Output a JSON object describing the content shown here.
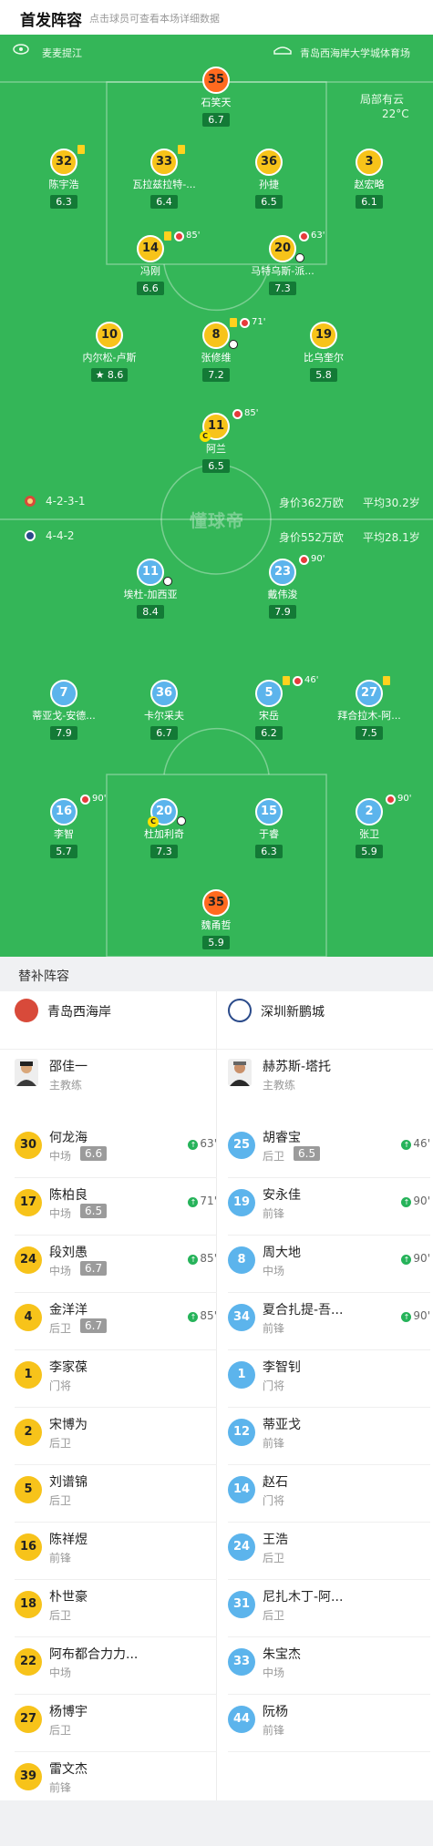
{
  "header": {
    "title": "首发阵容",
    "hint": "点击球员可查看本场详细数据"
  },
  "pitch": {
    "home_team": "麦麦提江",
    "venue": "青岛西海岸大学城体育场",
    "weather": "局部有云",
    "temperature": "22°C",
    "watermark": "懂球帝",
    "home_formation": "4-2-3-1",
    "home_value": "身价362万欧",
    "home_age": "平均30.2岁",
    "away_formation": "4-4-2",
    "away_value": "身价552万欧",
    "away_age": "平均28.1岁"
  },
  "home_players": [
    {
      "num": "35",
      "name": "石笑天",
      "rating": "6.7",
      "kind": "gk"
    },
    {
      "num": "32",
      "name": "陈宇浩",
      "rating": "6.3",
      "kind": "home",
      "yellow": true
    },
    {
      "num": "33",
      "name": "瓦拉兹拉特-...",
      "rating": "6.4",
      "kind": "home",
      "yellow": true
    },
    {
      "num": "36",
      "name": "孙捷",
      "rating": "6.5",
      "kind": "home"
    },
    {
      "num": "3",
      "name": "赵宏略",
      "rating": "6.1",
      "kind": "home"
    },
    {
      "num": "14",
      "name": "冯刚",
      "rating": "6.6",
      "kind": "home",
      "yellow": true,
      "sub_min": "85'"
    },
    {
      "num": "20",
      "name": "马特乌斯-派...",
      "rating": "7.3",
      "kind": "home",
      "sub_min": "63'",
      "goal": true
    },
    {
      "num": "10",
      "name": "内尔松-卢斯",
      "rating": "8.6",
      "kind": "home",
      "star": true
    },
    {
      "num": "8",
      "name": "张修维",
      "rating": "7.2",
      "kind": "home",
      "yellow": true,
      "sub_min": "71'",
      "goal": true
    },
    {
      "num": "19",
      "name": "比乌奎尔",
      "rating": "5.8",
      "kind": "home"
    },
    {
      "num": "11",
      "name": "阿兰",
      "rating": "6.5",
      "kind": "home",
      "sub_min": "85'",
      "captain": "C"
    }
  ],
  "away_players": [
    {
      "num": "11",
      "name": "埃杜-加西亚",
      "rating": "8.4",
      "kind": "away",
      "goal": true
    },
    {
      "num": "23",
      "name": "戴伟浚",
      "rating": "7.9",
      "kind": "away",
      "sub_min": "90'"
    },
    {
      "num": "7",
      "name": "蒂亚戈-安德...",
      "rating": "7.9",
      "kind": "away"
    },
    {
      "num": "36",
      "name": "卡尔采夫",
      "rating": "6.7",
      "kind": "away"
    },
    {
      "num": "5",
      "name": "宋岳",
      "rating": "6.2",
      "kind": "away",
      "yellow": true,
      "sub_min": "46'"
    },
    {
      "num": "27",
      "name": "拜合拉木-阿...",
      "rating": "7.5",
      "kind": "away",
      "yellow": true
    },
    {
      "num": "16",
      "name": "李智",
      "rating": "5.7",
      "kind": "away",
      "sub_min": "90'"
    },
    {
      "num": "20",
      "name": "杜加利奇",
      "rating": "7.3",
      "kind": "away",
      "captain": "C",
      "goal": true
    },
    {
      "num": "15",
      "name": "于睿",
      "rating": "6.3",
      "kind": "away"
    },
    {
      "num": "2",
      "name": "张卫",
      "rating": "5.9",
      "kind": "away",
      "sub_min": "90'"
    },
    {
      "num": "35",
      "name": "魏甬哲",
      "rating": "5.9",
      "kind": "gk"
    }
  ],
  "subs": {
    "title": "替补阵容",
    "home_name": "青岛西海岸",
    "away_name": "深圳新鹏城",
    "home_coach": {
      "name": "邵佳一",
      "role": "主教练"
    },
    "away_coach": {
      "name": "赫苏斯-塔托",
      "role": "主教练"
    },
    "home": [
      {
        "num": "30",
        "name": "何龙海",
        "pos": "中场",
        "rating": "6.6",
        "min": "63'"
      },
      {
        "num": "17",
        "name": "陈柏良",
        "pos": "中场",
        "rating": "6.5",
        "min": "71'"
      },
      {
        "num": "24",
        "name": "段刘愚",
        "pos": "中场",
        "rating": "6.7",
        "min": "85'"
      },
      {
        "num": "4",
        "name": "金洋洋",
        "pos": "后卫",
        "rating": "6.7",
        "min": "85'"
      },
      {
        "num": "1",
        "name": "李家葆",
        "pos": "门将"
      },
      {
        "num": "2",
        "name": "宋博为",
        "pos": "后卫"
      },
      {
        "num": "5",
        "name": "刘谱锦",
        "pos": "后卫"
      },
      {
        "num": "16",
        "name": "陈祥煜",
        "pos": "前锋"
      },
      {
        "num": "18",
        "name": "朴世豪",
        "pos": "后卫"
      },
      {
        "num": "22",
        "name": "阿布都合力力...",
        "pos": "中场"
      },
      {
        "num": "27",
        "name": "杨博宇",
        "pos": "后卫"
      },
      {
        "num": "39",
        "name": "雷文杰",
        "pos": "前锋"
      }
    ],
    "away": [
      {
        "num": "25",
        "name": "胡睿宝",
        "pos": "后卫",
        "rating": "6.5",
        "min": "46'"
      },
      {
        "num": "19",
        "name": "安永佳",
        "pos": "前锋",
        "min": "90'"
      },
      {
        "num": "8",
        "name": "周大地",
        "pos": "中场",
        "min": "90'"
      },
      {
        "num": "34",
        "name": "夏合扎提-吾...",
        "pos": "前锋",
        "min": "90'"
      },
      {
        "num": "1",
        "name": "李智钊",
        "pos": "门将"
      },
      {
        "num": "12",
        "name": "蒂亚戈",
        "pos": "前锋"
      },
      {
        "num": "14",
        "name": "赵石",
        "pos": "门将"
      },
      {
        "num": "24",
        "name": "王浩",
        "pos": "后卫"
      },
      {
        "num": "31",
        "name": "尼扎木丁-阿...",
        "pos": "后卫"
      },
      {
        "num": "33",
        "name": "朱宝杰",
        "pos": "中场"
      },
      {
        "num": "44",
        "name": "阮杨",
        "pos": "前锋"
      }
    ]
  },
  "colors": {
    "pitch": "#34b658",
    "home": "#f7c31a",
    "away": "#5cb4ec",
    "gk": "#ff6a1f"
  }
}
